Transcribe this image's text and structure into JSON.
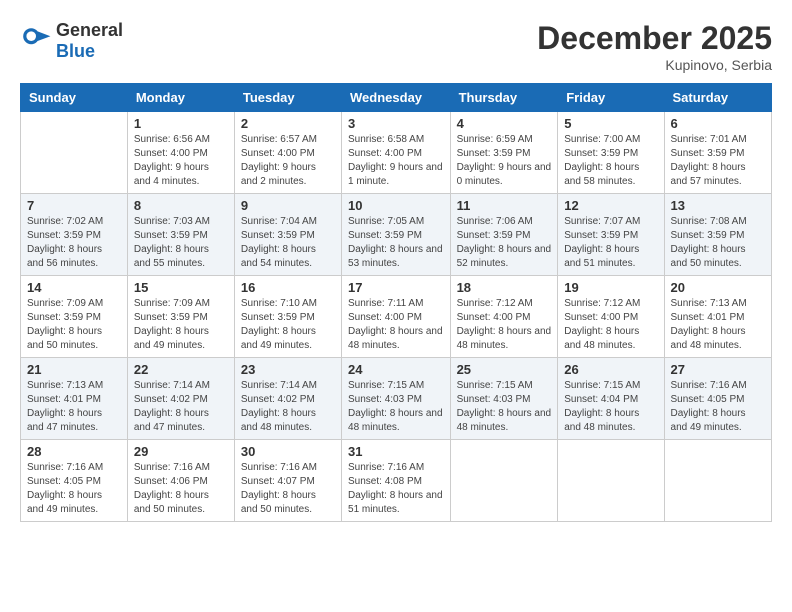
{
  "header": {
    "logo": {
      "general": "General",
      "blue": "Blue"
    },
    "title": "December 2025",
    "location": "Kupinovo, Serbia"
  },
  "weekdays": [
    "Sunday",
    "Monday",
    "Tuesday",
    "Wednesday",
    "Thursday",
    "Friday",
    "Saturday"
  ],
  "weeks": [
    [
      {
        "day": null
      },
      {
        "day": 1,
        "sunrise": "6:56 AM",
        "sunset": "4:00 PM",
        "daylight": "9 hours and 4 minutes."
      },
      {
        "day": 2,
        "sunrise": "6:57 AM",
        "sunset": "4:00 PM",
        "daylight": "9 hours and 2 minutes."
      },
      {
        "day": 3,
        "sunrise": "6:58 AM",
        "sunset": "4:00 PM",
        "daylight": "9 hours and 1 minute."
      },
      {
        "day": 4,
        "sunrise": "6:59 AM",
        "sunset": "3:59 PM",
        "daylight": "9 hours and 0 minutes."
      },
      {
        "day": 5,
        "sunrise": "7:00 AM",
        "sunset": "3:59 PM",
        "daylight": "8 hours and 58 minutes."
      },
      {
        "day": 6,
        "sunrise": "7:01 AM",
        "sunset": "3:59 PM",
        "daylight": "8 hours and 57 minutes."
      }
    ],
    [
      {
        "day": 7,
        "sunrise": "7:02 AM",
        "sunset": "3:59 PM",
        "daylight": "8 hours and 56 minutes."
      },
      {
        "day": 8,
        "sunrise": "7:03 AM",
        "sunset": "3:59 PM",
        "daylight": "8 hours and 55 minutes."
      },
      {
        "day": 9,
        "sunrise": "7:04 AM",
        "sunset": "3:59 PM",
        "daylight": "8 hours and 54 minutes."
      },
      {
        "day": 10,
        "sunrise": "7:05 AM",
        "sunset": "3:59 PM",
        "daylight": "8 hours and 53 minutes."
      },
      {
        "day": 11,
        "sunrise": "7:06 AM",
        "sunset": "3:59 PM",
        "daylight": "8 hours and 52 minutes."
      },
      {
        "day": 12,
        "sunrise": "7:07 AM",
        "sunset": "3:59 PM",
        "daylight": "8 hours and 51 minutes."
      },
      {
        "day": 13,
        "sunrise": "7:08 AM",
        "sunset": "3:59 PM",
        "daylight": "8 hours and 50 minutes."
      }
    ],
    [
      {
        "day": 14,
        "sunrise": "7:09 AM",
        "sunset": "3:59 PM",
        "daylight": "8 hours and 50 minutes."
      },
      {
        "day": 15,
        "sunrise": "7:09 AM",
        "sunset": "3:59 PM",
        "daylight": "8 hours and 49 minutes."
      },
      {
        "day": 16,
        "sunrise": "7:10 AM",
        "sunset": "3:59 PM",
        "daylight": "8 hours and 49 minutes."
      },
      {
        "day": 17,
        "sunrise": "7:11 AM",
        "sunset": "4:00 PM",
        "daylight": "8 hours and 48 minutes."
      },
      {
        "day": 18,
        "sunrise": "7:12 AM",
        "sunset": "4:00 PM",
        "daylight": "8 hours and 48 minutes."
      },
      {
        "day": 19,
        "sunrise": "7:12 AM",
        "sunset": "4:00 PM",
        "daylight": "8 hours and 48 minutes."
      },
      {
        "day": 20,
        "sunrise": "7:13 AM",
        "sunset": "4:01 PM",
        "daylight": "8 hours and 48 minutes."
      }
    ],
    [
      {
        "day": 21,
        "sunrise": "7:13 AM",
        "sunset": "4:01 PM",
        "daylight": "8 hours and 47 minutes."
      },
      {
        "day": 22,
        "sunrise": "7:14 AM",
        "sunset": "4:02 PM",
        "daylight": "8 hours and 47 minutes."
      },
      {
        "day": 23,
        "sunrise": "7:14 AM",
        "sunset": "4:02 PM",
        "daylight": "8 hours and 48 minutes."
      },
      {
        "day": 24,
        "sunrise": "7:15 AM",
        "sunset": "4:03 PM",
        "daylight": "8 hours and 48 minutes."
      },
      {
        "day": 25,
        "sunrise": "7:15 AM",
        "sunset": "4:03 PM",
        "daylight": "8 hours and 48 minutes."
      },
      {
        "day": 26,
        "sunrise": "7:15 AM",
        "sunset": "4:04 PM",
        "daylight": "8 hours and 48 minutes."
      },
      {
        "day": 27,
        "sunrise": "7:16 AM",
        "sunset": "4:05 PM",
        "daylight": "8 hours and 49 minutes."
      }
    ],
    [
      {
        "day": 28,
        "sunrise": "7:16 AM",
        "sunset": "4:05 PM",
        "daylight": "8 hours and 49 minutes."
      },
      {
        "day": 29,
        "sunrise": "7:16 AM",
        "sunset": "4:06 PM",
        "daylight": "8 hours and 50 minutes."
      },
      {
        "day": 30,
        "sunrise": "7:16 AM",
        "sunset": "4:07 PM",
        "daylight": "8 hours and 50 minutes."
      },
      {
        "day": 31,
        "sunrise": "7:16 AM",
        "sunset": "4:08 PM",
        "daylight": "8 hours and 51 minutes."
      },
      {
        "day": null
      },
      {
        "day": null
      },
      {
        "day": null
      }
    ]
  ],
  "labels": {
    "sunrise": "Sunrise:",
    "sunset": "Sunset:",
    "daylight": "Daylight:"
  }
}
